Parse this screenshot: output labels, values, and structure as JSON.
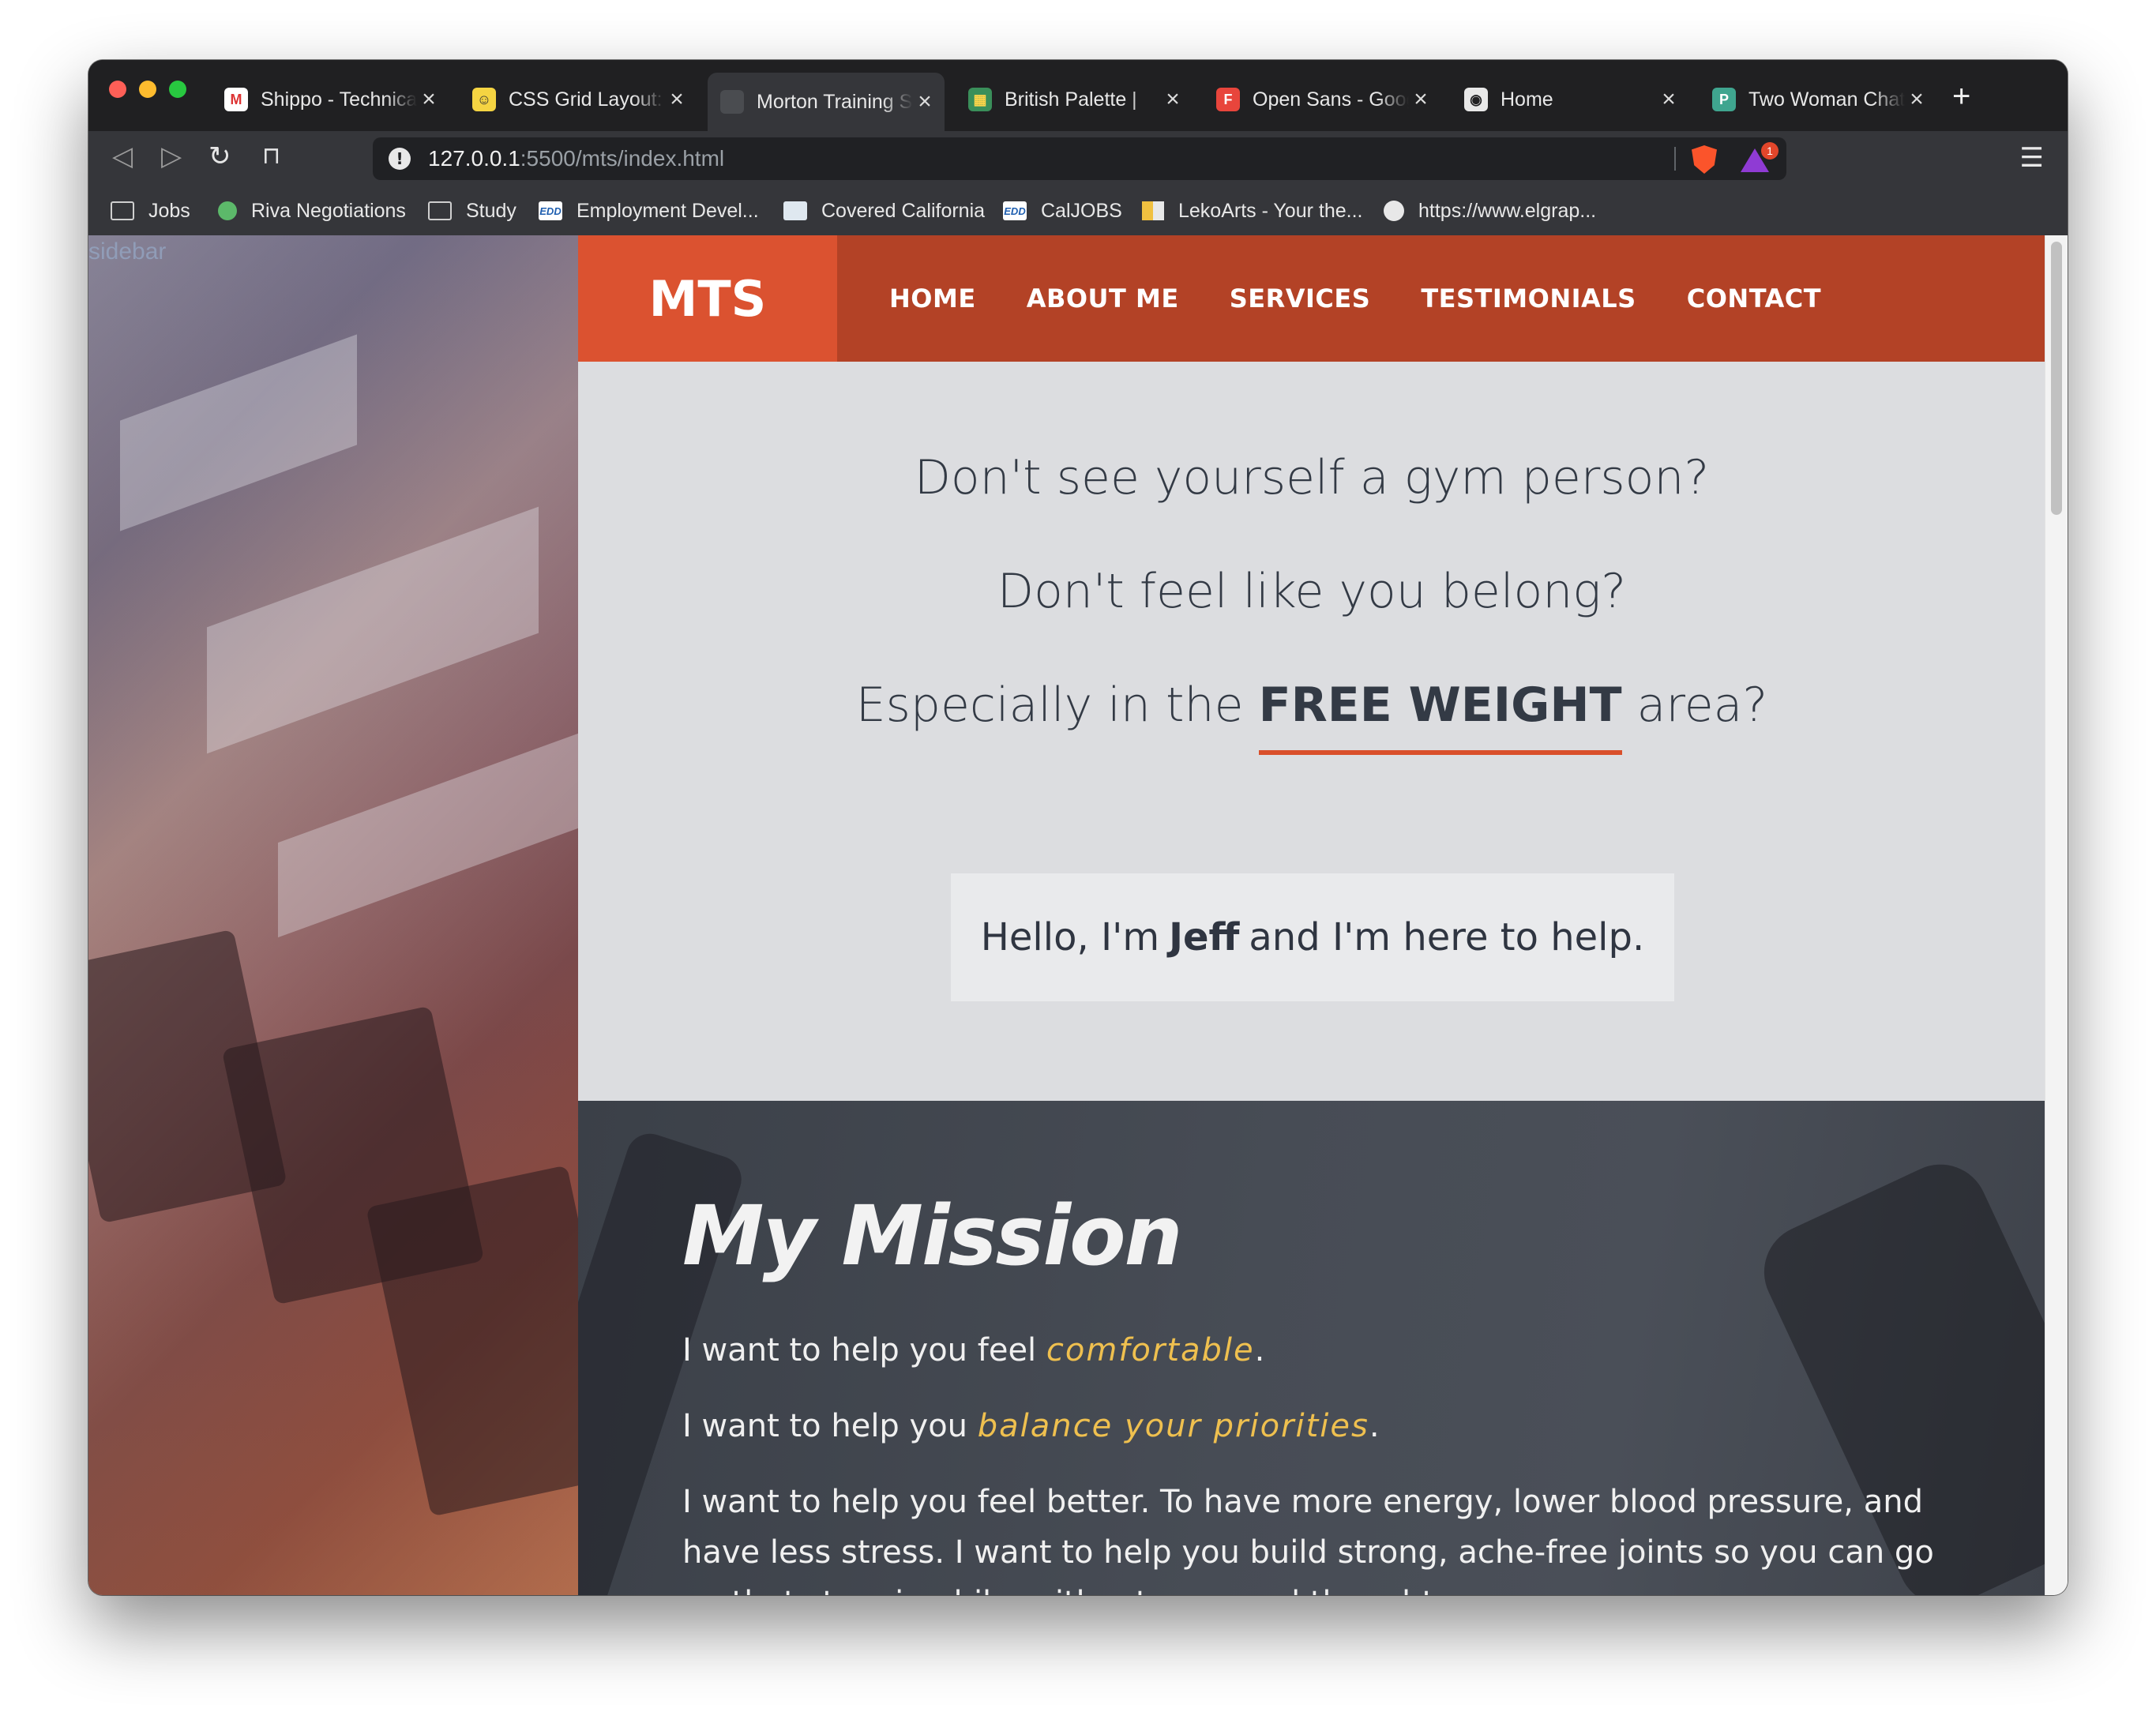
{
  "browser": {
    "tabs": [
      {
        "title": "Shippo - Technical",
        "fav_color": "#ffffff",
        "fav_text": "M",
        "fav_text_color": "#d33",
        "active": false
      },
      {
        "title": "CSS Grid Layout: T",
        "fav_color": "#f5d442",
        "fav_text": "☺",
        "fav_text_color": "#333",
        "active": false
      },
      {
        "title": "Morton Training Sy",
        "fav_color": "#4a4c50",
        "fav_text": "",
        "fav_text_color": "#fff",
        "active": true
      },
      {
        "title": "British Palette |",
        "fav_color": "#3a8f5a",
        "fav_text": "▦",
        "fav_text_color": "#ffd54a",
        "active": false
      },
      {
        "title": "Open Sans - Googl",
        "fav_color": "#e8453c",
        "fav_text": "F",
        "fav_text_color": "#fff",
        "active": false
      },
      {
        "title": "Home",
        "fav_color": "#e8e8e8",
        "fav_text": "◉",
        "fav_text_color": "#202022",
        "active": false
      },
      {
        "title": "Two Woman Chatt",
        "fav_color": "#3fa58f",
        "fav_text": "P",
        "fav_text_color": "#fff",
        "active": false
      }
    ],
    "url_host": "127.0.0.1",
    "url_rest": ":5500/mts/index.html",
    "rewards_count": "1",
    "bookmarks": [
      {
        "label": "Jobs",
        "icon": "folder-icon"
      },
      {
        "label": "Riva Negotiations",
        "icon": "riva-icon"
      },
      {
        "label": "Study",
        "icon": "folder-icon"
      },
      {
        "label": "Employment Devel...",
        "icon": "edd-icon"
      },
      {
        "label": "Covered California",
        "icon": "covered-ca-icon"
      },
      {
        "label": "CalJOBS",
        "icon": "edd-icon"
      },
      {
        "label": "LekoArts - Your the...",
        "icon": "lekoarts-icon"
      },
      {
        "label": "https://www.elgrap...",
        "icon": "globe-icon"
      }
    ]
  },
  "page": {
    "sidebar_label": "sidebar",
    "logo": "MTS",
    "nav": [
      "HOME",
      "ABOUT ME",
      "SERVICES",
      "TESTIMONIALS",
      "CONTACT"
    ],
    "hero": {
      "line1": "Don't see yourself a gym person?",
      "line2": "Don't feel like you belong?",
      "line3_pre": "Especially in the",
      "line3_bold": "FREE WEIGHT",
      "line3_post": "area?",
      "hello_pre": "Hello, I'm",
      "hello_name": "Jeff",
      "hello_post": "and I'm here to help."
    },
    "mission": {
      "title": "My Mission",
      "p1_pre": "I want to help you feel",
      "p1_hl": "comfortable",
      "p1_post": ".",
      "p2_pre": "I want to help you",
      "p2_hl": "balance your priorities",
      "p2_post": ".",
      "p3": "I want to help you feel better. To have more energy, lower blood pressure, and have less stress. I want to help you build strong, ache-free joints so you can go on that stunning hike without a second thought."
    }
  },
  "colors": {
    "nav_bg": "#b34226",
    "logo_bg": "#db5230",
    "hero_bg": "#dcdde0",
    "accent_underline": "#d94f2b",
    "mission_highlight": "#efc04f"
  }
}
